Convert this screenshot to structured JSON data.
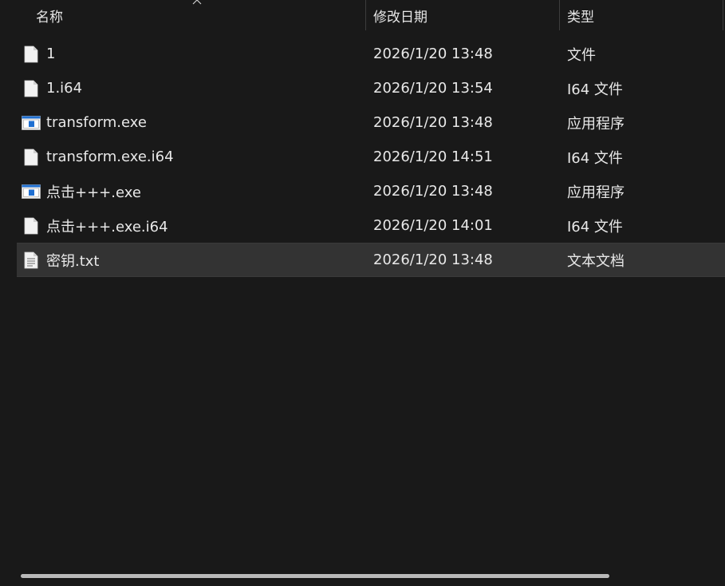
{
  "columns": {
    "name": "名称",
    "date": "修改日期",
    "type": "类型"
  },
  "files": [
    {
      "icon": "file-icon",
      "name": "1",
      "date": "2026/1/20 13:48",
      "type": "文件"
    },
    {
      "icon": "file-icon",
      "name": "1.i64",
      "date": "2026/1/20 13:54",
      "type": "I64 文件"
    },
    {
      "icon": "exe-icon",
      "name": "transform.exe",
      "date": "2026/1/20 13:48",
      "type": "应用程序"
    },
    {
      "icon": "file-icon",
      "name": "transform.exe.i64",
      "date": "2026/1/20 14:51",
      "type": "I64 文件"
    },
    {
      "icon": "exe-icon",
      "name": "点击+++.exe",
      "date": "2026/1/20 13:48",
      "type": "应用程序"
    },
    {
      "icon": "file-icon",
      "name": "点击+++.exe.i64",
      "date": "2026/1/20 14:01",
      "type": "I64 文件"
    },
    {
      "icon": "text-file-icon",
      "name": "密钥.txt",
      "date": "2026/1/20 13:48",
      "type": "文本文档"
    }
  ],
  "colors": {
    "background": "#191919",
    "selected_row": "#333333",
    "text": "#e8e8e8",
    "exe_accent": "#1f6fd1"
  }
}
